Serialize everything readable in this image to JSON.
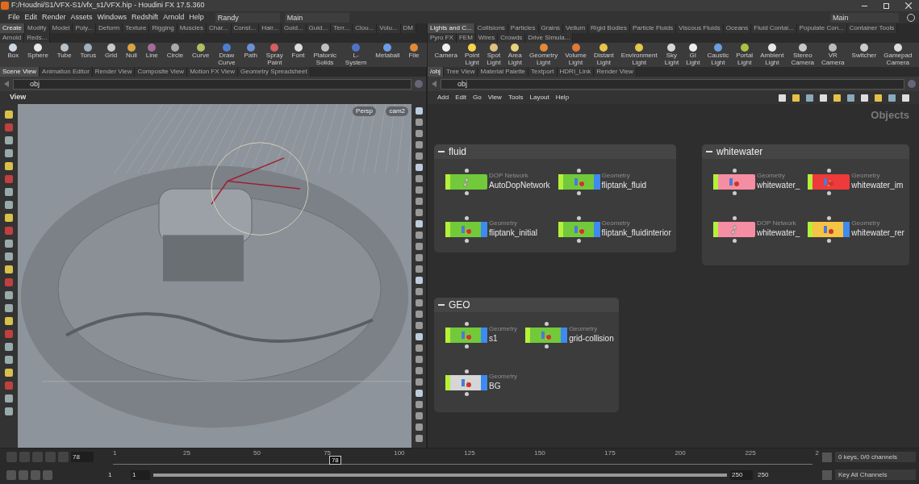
{
  "window": {
    "title": "F:/Houdni/S1/VFX-S1/vfx_s1/VFX.hip - Houdini FX 17.5.360"
  },
  "menu": [
    "File",
    "Edit",
    "Render",
    "Assets",
    "Windows",
    "Redshift",
    "Arnold",
    "Help"
  ],
  "desktop": "Randy",
  "run_mode": "Main",
  "right_run_mode": "Main",
  "left_shelf": {
    "tabs": [
      {
        "label": "Create",
        "selected": true
      },
      {
        "label": "Modify",
        "selected": false
      },
      {
        "label": "Model",
        "selected": false
      },
      {
        "label": "Poly...",
        "selected": false
      },
      {
        "label": "Deform",
        "selected": false
      },
      {
        "label": "Texture",
        "selected": false
      },
      {
        "label": "Rigging",
        "selected": false
      },
      {
        "label": "Muscles",
        "selected": false
      },
      {
        "label": "Char...",
        "selected": false
      },
      {
        "label": "Const...",
        "selected": false
      },
      {
        "label": "Hair...",
        "selected": false
      },
      {
        "label": "Guid...",
        "selected": false
      },
      {
        "label": "Guid...",
        "selected": false
      },
      {
        "label": "Terr...",
        "selected": false
      },
      {
        "label": "Clou...",
        "selected": false
      },
      {
        "label": "Volu...",
        "selected": false
      },
      {
        "label": "DM",
        "selected": false
      },
      {
        "label": "Arnold",
        "selected": false
      },
      {
        "label": "Reds...",
        "selected": false
      }
    ],
    "tools": [
      "Box",
      "Sphere",
      "Tube",
      "Torus",
      "Grid",
      "Null",
      "Line",
      "Circle",
      "Curve",
      "Draw Curve",
      "Path",
      "Spray Paint",
      "Font",
      "Platonic Solids",
      "L-System",
      "Metaball",
      "File"
    ]
  },
  "right_shelf": {
    "tabs": [
      {
        "label": "Lights and C...",
        "selected": true
      },
      {
        "label": "Collisions",
        "selected": false
      },
      {
        "label": "Particles",
        "selected": false
      },
      {
        "label": "Grains",
        "selected": false
      },
      {
        "label": "Vellum",
        "selected": false
      },
      {
        "label": "Rigid Bodies",
        "selected": false
      },
      {
        "label": "Particle Fluids",
        "selected": false
      },
      {
        "label": "Viscous Fluids",
        "selected": false
      },
      {
        "label": "Oceans",
        "selected": false
      },
      {
        "label": "Fluid Contai...",
        "selected": false
      },
      {
        "label": "Populate Con...",
        "selected": false
      },
      {
        "label": "Container Tools",
        "selected": false
      },
      {
        "label": "Pyro FX",
        "selected": false
      },
      {
        "label": "FEM",
        "selected": false
      },
      {
        "label": "Wires",
        "selected": false
      },
      {
        "label": "Crowds",
        "selected": false
      },
      {
        "label": "Drive Simula...",
        "selected": false
      }
    ],
    "tools": [
      "Camera",
      "Point Light",
      "Spot Light",
      "Area Light",
      "Geometry Light",
      "Volume Light",
      "Distant Light",
      "Environment Light",
      "Sky Light",
      "GI Light",
      "Caustic Light",
      "Portal Light",
      "Ambient Light",
      "Stereo Camera",
      "VR Camera",
      "Switcher",
      "Gamepad Camera"
    ]
  },
  "scene_pane": {
    "tabs": [
      {
        "label": "Scene View",
        "selected": true
      },
      {
        "label": "Animation Editor",
        "selected": false
      },
      {
        "label": "Render View",
        "selected": false
      },
      {
        "label": "Composite View",
        "selected": false
      },
      {
        "label": "Motion FX View",
        "selected": false
      },
      {
        "label": "Geometry Spreadsheet",
        "selected": false
      }
    ],
    "path": "obj",
    "title": "View",
    "camera_menus": [
      "Persp",
      "cam2"
    ]
  },
  "network_pane": {
    "tabs": [
      {
        "label": "/obj",
        "selected": true
      },
      {
        "label": "Tree View",
        "selected": false
      },
      {
        "label": "Material Palette",
        "selected": false
      },
      {
        "label": "Textport",
        "selected": false
      },
      {
        "label": "HDRI_Link",
        "selected": false
      },
      {
        "label": "Render View",
        "selected": false
      }
    ],
    "path": "obj",
    "menu": [
      "Add",
      "Edit",
      "Go",
      "View",
      "Tools",
      "Layout",
      "Help"
    ],
    "context": "Objects",
    "boxes": [
      {
        "title": "fluid",
        "nodes": [
          {
            "type": "DOP Network",
            "name": "AutoDopNetwork",
            "color": "#72c93a",
            "kind": "dop",
            "display": false
          },
          {
            "type": "Geometry",
            "name": "fliptank_fluid",
            "color": "#72c93a",
            "kind": "geo",
            "display": true
          },
          {
            "type": "Geometry",
            "name": "fliptank_initial",
            "color": "#72c93a",
            "kind": "geo",
            "display": true
          },
          {
            "type": "Geometry",
            "name": "fliptank_fluidinterior",
            "color": "#72c93a",
            "kind": "geo",
            "display": true
          }
        ]
      },
      {
        "title": "whitewater",
        "nodes": [
          {
            "type": "Geometry",
            "name": "whitewater_",
            "color": "#f58ea3",
            "kind": "geo",
            "display": false
          },
          {
            "type": "Geometry",
            "name": "whitewater_im",
            "color": "#ee3a3a",
            "kind": "geo",
            "display": false
          },
          {
            "type": "DOP Network",
            "name": "whitewater_",
            "color": "#f58ea3",
            "kind": "dop",
            "display": false
          },
          {
            "type": "Geometry",
            "name": "whitewater_rer",
            "color": "#f6c344",
            "kind": "geo",
            "display": true
          }
        ]
      },
      {
        "title": "GEO",
        "nodes": [
          {
            "type": "Geometry",
            "name": "s1",
            "color": "#72c93a",
            "kind": "geo",
            "display": true
          },
          {
            "type": "Geometry",
            "name": "grid-collision",
            "color": "#72c93a",
            "kind": "geo",
            "display": true
          },
          {
            "type": "Geometry",
            "name": "BG",
            "color": "#d6d6d6",
            "kind": "geo",
            "display": true
          }
        ]
      }
    ]
  },
  "timeline": {
    "frame": "78",
    "marker": "78",
    "level": 0.309,
    "ticks": [
      "1",
      "25",
      "50",
      "75",
      "100",
      "125",
      "150",
      "175",
      "200",
      "225",
      "2"
    ],
    "keys_info": "0 keys, 0/0 channels",
    "key_button": "Key All Channels",
    "range_start": "1",
    "range_current_start": "1",
    "range_end": "250",
    "range_total_end": "250",
    "range_bar": {
      "level": 1
    }
  }
}
